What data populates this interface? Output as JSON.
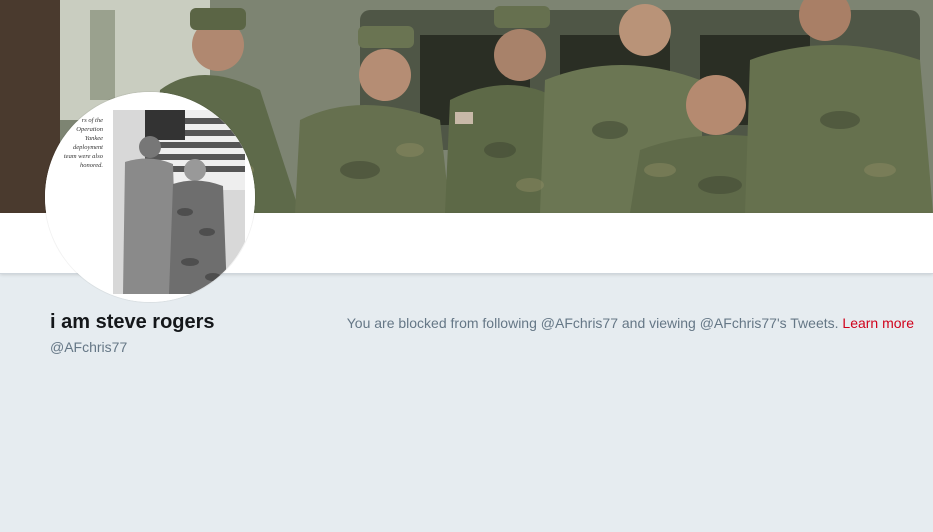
{
  "banner": {
    "alt": "Header photo of soldiers in camouflage uniforms"
  },
  "avatar": {
    "caption_lines": [
      "rs of the",
      "Operation",
      "Yankee",
      "deployment",
      "team were also",
      "honored."
    ]
  },
  "profile": {
    "name": "i am steve rogers",
    "handle": "@AFchris77"
  },
  "notice": {
    "text": "You are blocked from following @AFchris77 and viewing @AFchris77's Tweets.",
    "link_label": "Learn more"
  },
  "colors": {
    "background": "#e6ecf0",
    "name": "#14171a",
    "secondary_text": "#657786",
    "link": "#d0021b"
  }
}
